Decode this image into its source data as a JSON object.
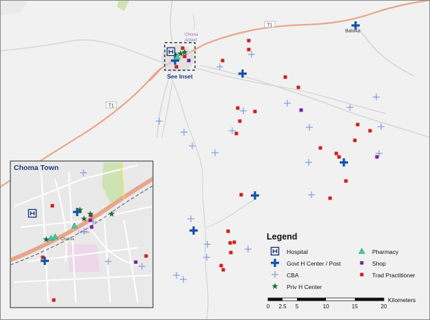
{
  "map": {
    "labels": {
      "road_main": "T1",
      "road_secondary": "T1",
      "town_batoka": "Batoka",
      "airport": "Choma Airport",
      "airport_line1": "Choma",
      "airport_line2": "Airport",
      "see_inset": "See Inset"
    },
    "inset": {
      "title": "Choma Town",
      "town_label": "Choma",
      "area_label": "Choma"
    }
  },
  "legend": {
    "title": "Legend",
    "items": [
      {
        "label": "Hospital",
        "symbol": "hospital-icon"
      },
      {
        "label": "Govt  H Center / Post",
        "symbol": "govt-cross-icon"
      },
      {
        "label": "CBA",
        "symbol": "cba-plus-icon"
      },
      {
        "label": "Priv H Center",
        "symbol": "star-icon"
      },
      {
        "label": "Pharmacy",
        "symbol": "triangle-icon"
      },
      {
        "label": "Shop",
        "symbol": "square-icon"
      },
      {
        "label": "Trad Practitioner",
        "symbol": "small-square-icon"
      }
    ],
    "colors": {
      "hospital": "#1f3b7a",
      "govt": "#1350a8",
      "cba": "#7f9fe0",
      "priv": "#1c6b3a",
      "pharmacy": "#46c6a1",
      "shop": "#7a1f9c",
      "trad": "#d01c1c"
    }
  },
  "scale": {
    "unit": "Kilometers",
    "ticks": [
      "0",
      "2.5",
      "5",
      "10",
      "15",
      "20"
    ]
  }
}
